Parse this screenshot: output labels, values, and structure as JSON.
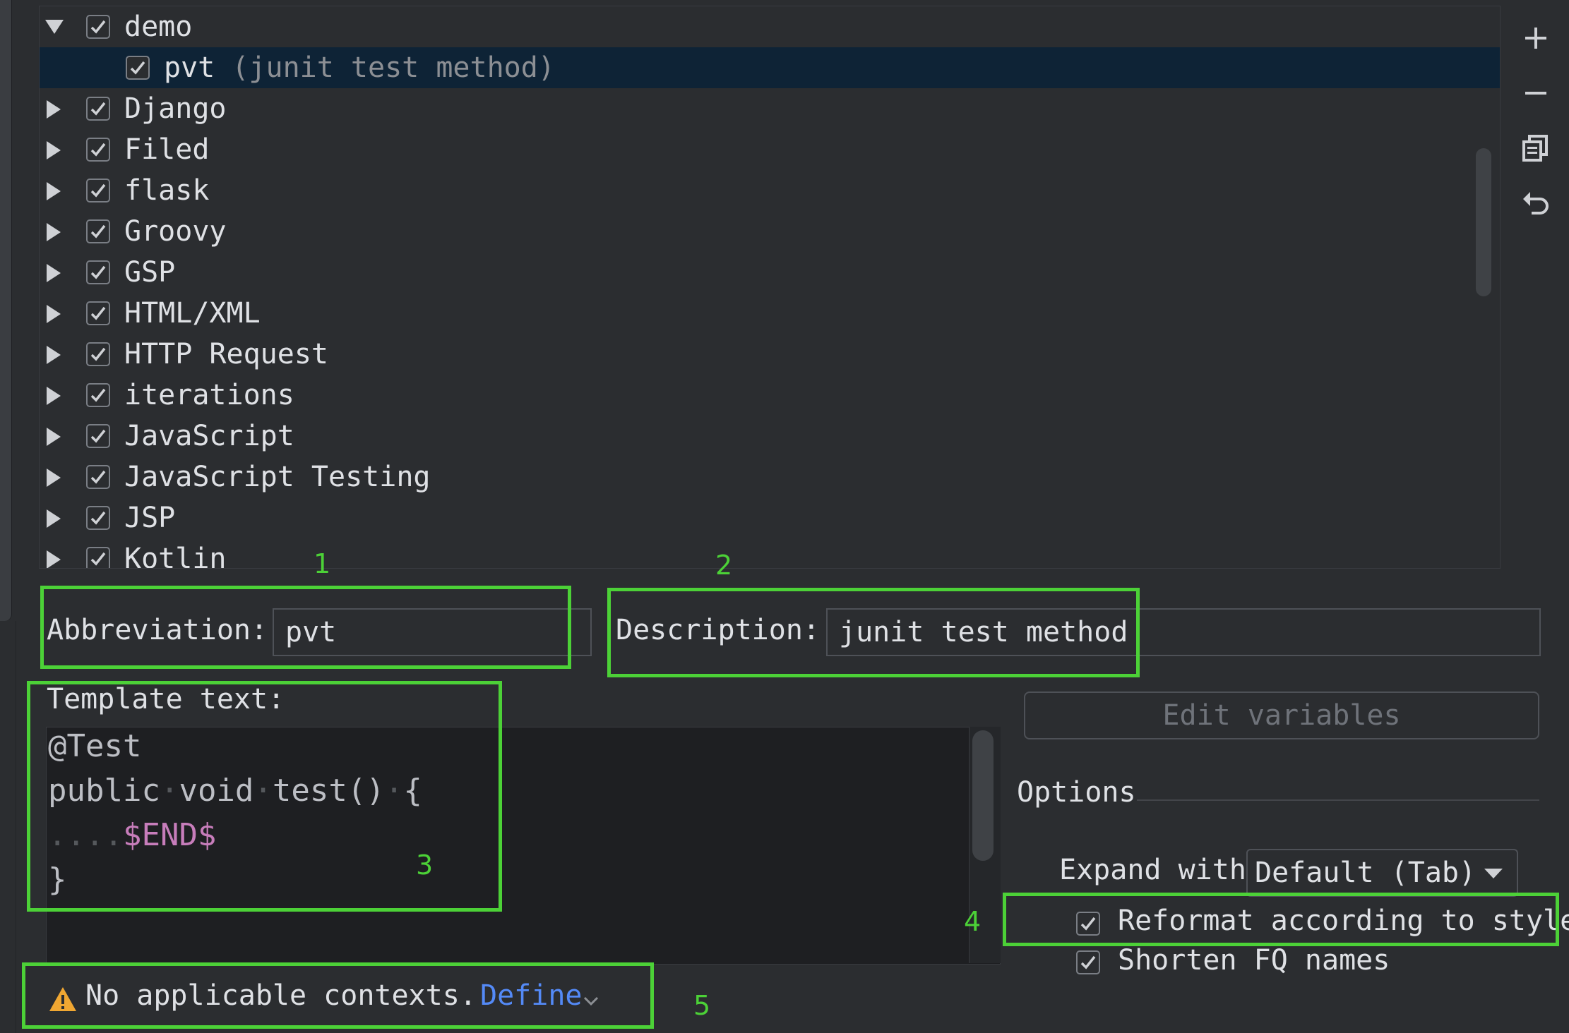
{
  "tree": {
    "rows": [
      {
        "label": "demo",
        "desc": "",
        "expanded": true,
        "checked": true,
        "child": false
      },
      {
        "label": "pvt",
        "desc": "(junit test method)",
        "expanded": false,
        "checked": true,
        "child": true
      },
      {
        "label": "Django",
        "desc": "",
        "expanded": false,
        "checked": true,
        "child": false
      },
      {
        "label": "Filed",
        "desc": "",
        "expanded": false,
        "checked": true,
        "child": false
      },
      {
        "label": "flask",
        "desc": "",
        "expanded": false,
        "checked": true,
        "child": false
      },
      {
        "label": "Groovy",
        "desc": "",
        "expanded": false,
        "checked": true,
        "child": false
      },
      {
        "label": "GSP",
        "desc": "",
        "expanded": false,
        "checked": true,
        "child": false
      },
      {
        "label": "HTML/XML",
        "desc": "",
        "expanded": false,
        "checked": true,
        "child": false
      },
      {
        "label": "HTTP Request",
        "desc": "",
        "expanded": false,
        "checked": true,
        "child": false
      },
      {
        "label": "iterations",
        "desc": "",
        "expanded": false,
        "checked": true,
        "child": false
      },
      {
        "label": "JavaScript",
        "desc": "",
        "expanded": false,
        "checked": true,
        "child": false
      },
      {
        "label": "JavaScript Testing",
        "desc": "",
        "expanded": false,
        "checked": true,
        "child": false
      },
      {
        "label": "JSP",
        "desc": "",
        "expanded": false,
        "checked": true,
        "child": false
      },
      {
        "label": "Kotlin",
        "desc": "",
        "expanded": false,
        "checked": true,
        "child": false
      }
    ]
  },
  "toolbar": {
    "add_icon": "plus-icon",
    "remove_icon": "minus-icon",
    "copy_icon": "copy-icon",
    "revert_icon": "undo-icon"
  },
  "abbreviation": {
    "label": "Abbreviation:",
    "value": "pvt"
  },
  "description": {
    "label": "Description:",
    "value": "junit test method"
  },
  "template": {
    "label": "Template text:",
    "lines": {
      "l1": "@Test",
      "l2a": "public",
      "l2b": "void",
      "l2c": "test()",
      "l2d": "{",
      "l3dots": "....",
      "l3var": "$END$",
      "l4": "}"
    }
  },
  "edit_variables": "Edit variables",
  "options": {
    "title": "Options",
    "expand_label": "Expand with",
    "expand_value": "Default (Tab)",
    "reformat": "Reformat according to style",
    "shorten": "Shorten FQ names"
  },
  "warning": {
    "text": "No applicable contexts.",
    "link": "Define"
  },
  "annotations": {
    "n1": "1",
    "n2": "2",
    "n3": "3",
    "n4": "4",
    "n5": "5"
  },
  "colors": {
    "annotation": "#4cd137",
    "selection": "#0e2336",
    "link": "#548af7",
    "template_var": "#c77dbb",
    "warning": "#f0a732"
  }
}
